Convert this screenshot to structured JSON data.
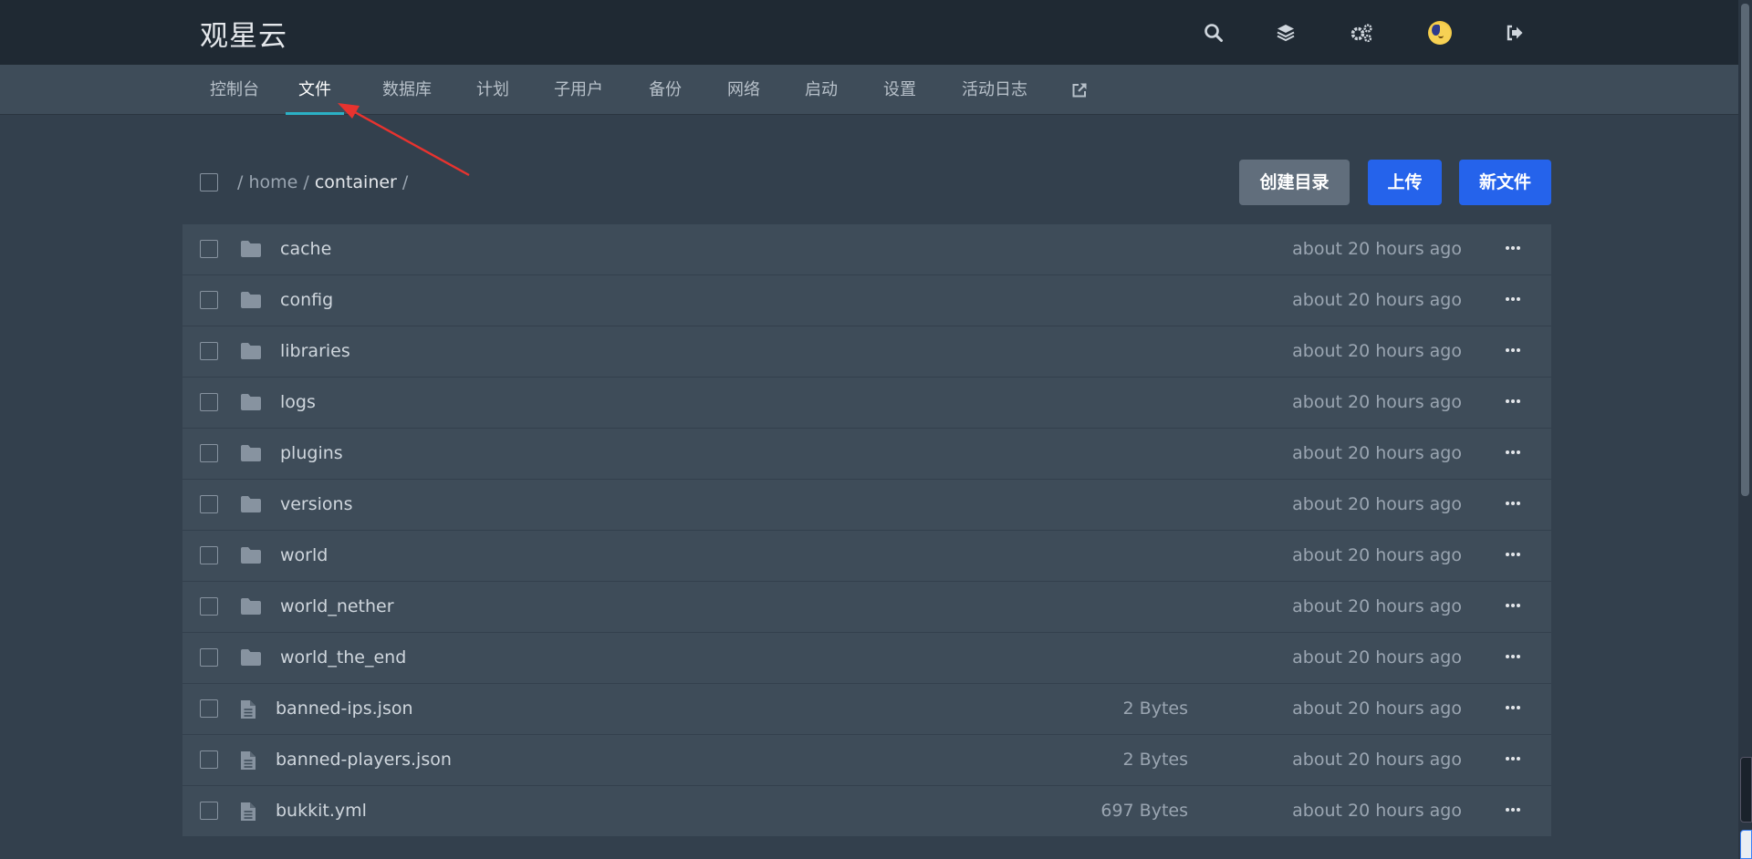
{
  "header": {
    "brand": "观星云",
    "icons": [
      "search-icon",
      "layers-icon",
      "cogs-icon",
      "avatar",
      "sign-out-icon"
    ]
  },
  "nav": {
    "items": [
      {
        "label": "控制台"
      },
      {
        "label": "文件"
      },
      {
        "label": "数据库"
      },
      {
        "label": "计划"
      },
      {
        "label": "子用户"
      },
      {
        "label": "备份"
      },
      {
        "label": "网络"
      },
      {
        "label": "启动"
      },
      {
        "label": "设置"
      },
      {
        "label": "活动日志"
      }
    ],
    "active": "文件",
    "external_icon": "external-link-icon"
  },
  "breadcrumb": {
    "sep": "/",
    "parts": [
      "home",
      "container"
    ]
  },
  "actions": {
    "create_dir": "创建目录",
    "upload": "上传",
    "new_file": "新文件"
  },
  "files": [
    {
      "type": "folder",
      "name": "cache",
      "size": "",
      "modified": "about 20 hours ago"
    },
    {
      "type": "folder",
      "name": "config",
      "size": "",
      "modified": "about 20 hours ago"
    },
    {
      "type": "folder",
      "name": "libraries",
      "size": "",
      "modified": "about 20 hours ago"
    },
    {
      "type": "folder",
      "name": "logs",
      "size": "",
      "modified": "about 20 hours ago"
    },
    {
      "type": "folder",
      "name": "plugins",
      "size": "",
      "modified": "about 20 hours ago"
    },
    {
      "type": "folder",
      "name": "versions",
      "size": "",
      "modified": "about 20 hours ago"
    },
    {
      "type": "folder",
      "name": "world",
      "size": "",
      "modified": "about 20 hours ago"
    },
    {
      "type": "folder",
      "name": "world_nether",
      "size": "",
      "modified": "about 20 hours ago"
    },
    {
      "type": "folder",
      "name": "world_the_end",
      "size": "",
      "modified": "about 20 hours ago"
    },
    {
      "type": "file",
      "name": "banned-ips.json",
      "size": "2 Bytes",
      "modified": "about 20 hours ago"
    },
    {
      "type": "file",
      "name": "banned-players.json",
      "size": "2 Bytes",
      "modified": "about 20 hours ago"
    },
    {
      "type": "file",
      "name": "bukkit.yml",
      "size": "697 Bytes",
      "modified": "about 20 hours ago"
    }
  ],
  "colors": {
    "topbar": "#1f2933",
    "navbar": "#3e4c59",
    "active_underline": "#2bb1c6",
    "primary_button": "#2563eb",
    "secondary_button": "#616e7c",
    "annotation_arrow": "#e8332f"
  }
}
